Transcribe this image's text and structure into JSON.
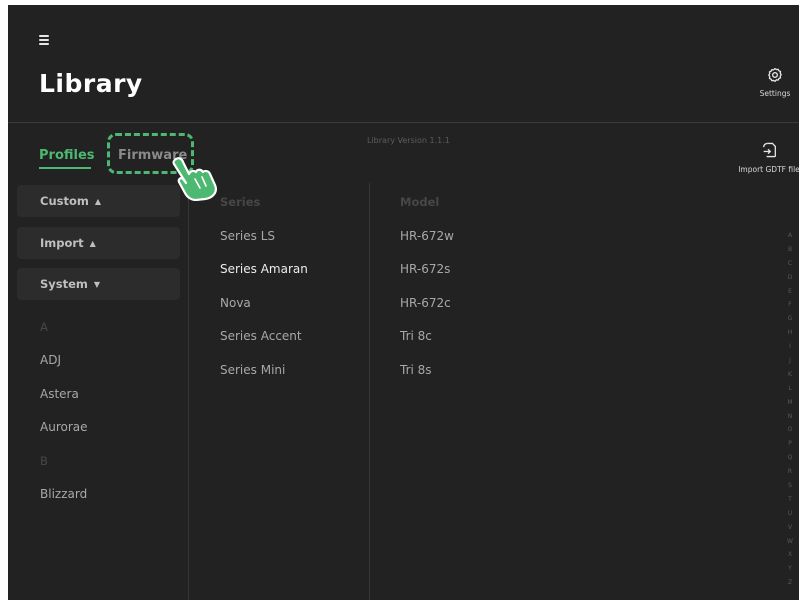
{
  "header": {
    "title": "Library",
    "settings_label": "Settings",
    "version": "Library Version 1.1.1",
    "import_label": "Import GDTF file"
  },
  "tabs": [
    {
      "label": "Profiles",
      "active": true
    },
    {
      "label": "Firmware",
      "active": false
    }
  ],
  "groups": [
    {
      "label": "Custom",
      "arrow": "▲"
    },
    {
      "label": "Import",
      "arrow": "▲"
    },
    {
      "label": "System",
      "arrow": "▼"
    }
  ],
  "brands": {
    "letter_a": "A",
    "letter_b": "B",
    "items": [
      "ADJ",
      "Astera",
      "Aurorae",
      "Blizzard"
    ]
  },
  "series": {
    "header": "Series",
    "items": [
      "Series LS",
      "Series Amaran",
      "Nova",
      "Series Accent",
      "Series Mini"
    ],
    "selected": "Series Amaran"
  },
  "models": {
    "header": "Model",
    "items": [
      "HR-672w",
      "HR-672s",
      "HR-672c",
      "Tri 8c",
      "Tri 8s"
    ]
  },
  "alphabet": [
    "A",
    "B",
    "C",
    "D",
    "E",
    "F",
    "G",
    "H",
    "I",
    "J",
    "K",
    "L",
    "M",
    "N",
    "O",
    "P",
    "Q",
    "R",
    "S",
    "T",
    "U",
    "V",
    "W",
    "X",
    "Y",
    "Z"
  ],
  "colors": {
    "accent": "#4db872",
    "background": "#222222",
    "button_bg": "#2c2c2c"
  },
  "icons": {
    "menu": "menu-icon",
    "settings": "gear-icon",
    "import": "import-file-icon",
    "cursor": "hand-pointer-icon"
  }
}
